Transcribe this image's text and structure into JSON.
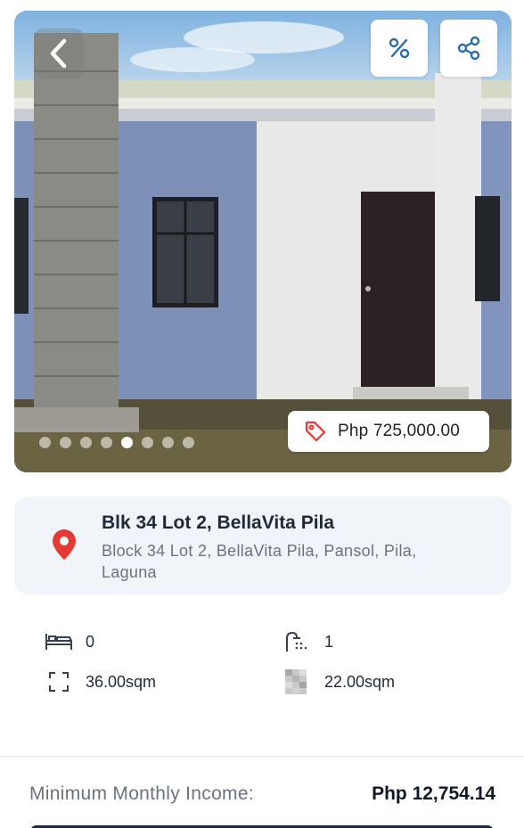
{
  "listing": {
    "price": "Php 725,000.00",
    "photo_count": 8,
    "active_photo_index": 4
  },
  "address": {
    "title": "Blk 34 Lot 2, BellaVita Pila",
    "full": "Block 34 Lot 2, BellaVita Pila, Pansol, Pila, Laguna"
  },
  "specs": {
    "bedrooms": "0",
    "bathrooms": "1",
    "floor_area": "36.00sqm",
    "lot_area": "22.00sqm"
  },
  "income": {
    "label": "Minimum Monthly Income:",
    "value": "Php 12,754.14"
  },
  "colors": {
    "accent_blue": "#2b6cb0",
    "pin_red": "#e53935",
    "button_navy": "#1e2a4a"
  },
  "icons": [
    "chevron-left-icon",
    "percent-icon",
    "share-icon",
    "price-tag-icon",
    "location-pin-icon",
    "bed-icon",
    "bath-icon",
    "floor-area-icon",
    "lot-area-icon"
  ]
}
